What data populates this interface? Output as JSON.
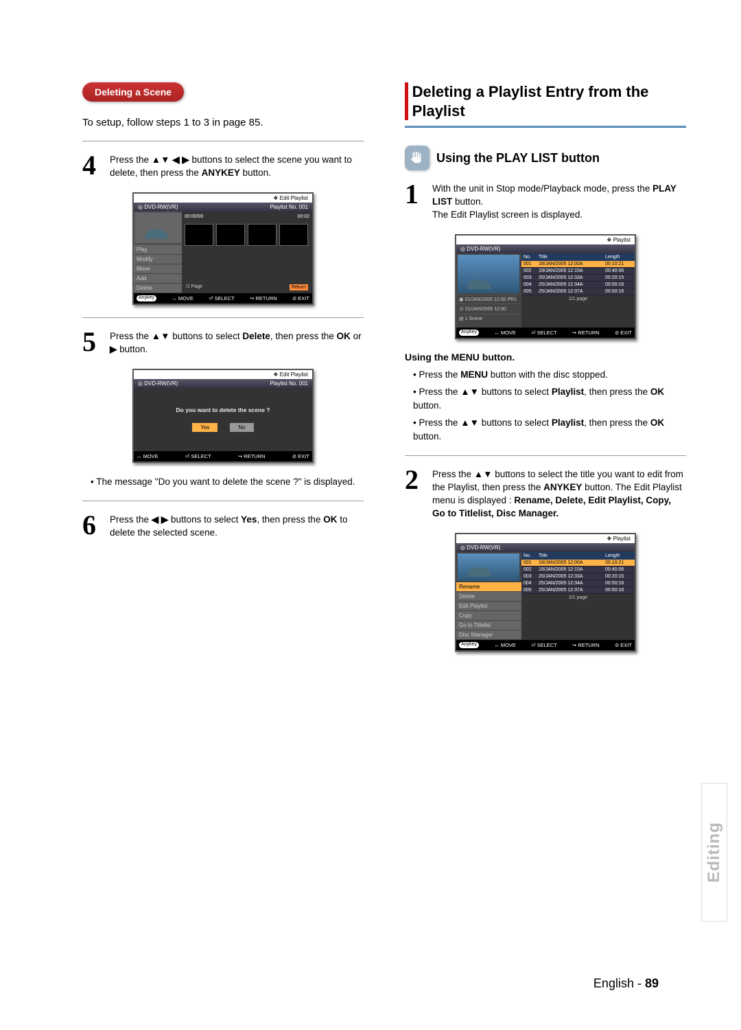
{
  "left": {
    "pill": "Deleting a Scene",
    "setup": "To setup, follow steps 1 to 3 in page 85.",
    "step4": {
      "num": "4",
      "pre": "Press the ",
      "arrows": "▲▼ ◀ ▶",
      "mid": " buttons to select the scene you want to delete, then press the ",
      "bold": "ANYKEY",
      "post": " button."
    },
    "ss1": {
      "top": "❖  Edit Playlist",
      "barL": "◎ DVD-RW(VR)",
      "barR": "Playlist No. 001",
      "side": [
        "Play",
        "Modify",
        "Move",
        "Add",
        "Delete"
      ],
      "tL": "00:00/00",
      "tR": "00:02",
      "pg": "/1 Page",
      "ret": "Return",
      "foot": {
        "ak": "Anykey",
        "mv": "↔ MOVE",
        "sel": "⏎ SELECT",
        "ret": "↪ RETURN",
        "ex": "⊘ EXIT"
      }
    },
    "step5": {
      "num": "5",
      "pre": "Press the ",
      "arrows": "▲▼",
      "mid": " buttons to select ",
      "b1": "Delete",
      "mid2": ", then press the ",
      "b2": "OK",
      "mid3": " or ",
      "arrow2": "▶",
      "post": " button."
    },
    "ss2": {
      "top": "❖  Edit Playlist",
      "barL": "◎ DVD-RW(VR)",
      "barR": "Playlist No. 001",
      "q": "Do you want to delete the scene ?",
      "yes": "Yes",
      "no": "No",
      "foot": {
        "mv": "↔ MOVE",
        "sel": "⏎ SELECT",
        "ret": "↪ RETURN",
        "ex": "⊘ EXIT"
      }
    },
    "bullet5": "The message \"Do you want to delete the scene ?\" is displayed.",
    "step6": {
      "num": "6",
      "pre": "Press the ",
      "arrows": "◀ ▶",
      "mid": " buttons to select ",
      "b1": "Yes",
      "mid2": ", then press the ",
      "b2": "OK",
      "post": " to delete the selected scene."
    }
  },
  "right": {
    "h2": "Deleting a Playlist Entry from the Playlist",
    "h3": "Using the PLAY LIST button",
    "step1": {
      "num": "1",
      "l1a": "With the unit in Stop mode/Playback mode, press the ",
      "l1b": "PLAY LIST",
      "l1c": " button.",
      "l2": "The Edit Playlist screen is displayed."
    },
    "ss3": {
      "top": "❖  Playlist",
      "barL": "◎ DVD-RW(VR)",
      "head": [
        "No.",
        "Title",
        "Length"
      ],
      "rows": [
        [
          "001",
          "18/JAN/2005 12:00A",
          "00:10:21"
        ],
        [
          "002",
          "19/JAN/2005 12:15A",
          "00:40:06"
        ],
        [
          "003",
          "20/JAN/2005 12:33A",
          "00:20:15"
        ],
        [
          "004",
          "25/JAN/2005 12:34A",
          "00:50:16"
        ],
        [
          "005",
          "25/JAN/2005 12:37A",
          "00:50:16"
        ]
      ],
      "info": [
        "▣ 01/JAN/2005 12:00 PR1",
        "⦿ 01/JAN/2005 12:00",
        "▤ 1 Scene"
      ],
      "page": "1/1 page",
      "foot": {
        "ak": "Anykey",
        "mv": "↔ MOVE",
        "sel": "⏎ SELECT",
        "ret": "↪ RETURN",
        "ex": "⊘ EXIT"
      }
    },
    "menuHead": "Using the MENU button.",
    "menu": {
      "b1a": "Press the ",
      "b1b": "MENU",
      "b1c": " button with the disc stopped.",
      "b2a": "Press the ",
      "b2arr": "▲▼",
      "b2b": " buttons to select ",
      "b2c": "Playlist",
      "b2d": ", then press the ",
      "b2e": "OK",
      "b2f": " button.",
      "b3a": "Press the ",
      "b3arr": "▲▼",
      "b3b": " buttons to select ",
      "b3c": "Playlist",
      "b3d": ", then press the ",
      "b3e": "OK",
      "b3f": " button."
    },
    "step2": {
      "num": "2",
      "l1a": "Press the ",
      "l1arr": "▲▼",
      "l1b": " buttons to select the title you want to edit from the Playlist, then press the ",
      "l1c": "ANYKEY",
      "l1d": " button.",
      "l2a": "The Edit Playlist menu is displayed : ",
      "l2items": "Rename, Delete, Edit Playlist, Copy, Go to Titlelist, Disc Manager."
    },
    "ss4": {
      "top": "❖  Playlist",
      "barL": "◎ DVD-RW(VR)",
      "head": [
        "No.",
        "Title",
        "Length"
      ],
      "side": [
        "Rename",
        "Delete",
        "Edit Playlist",
        "Copy",
        "Go to Titlelist",
        "Disc Manager"
      ],
      "rows": [
        [
          "001",
          "18/JAN/2005 12:00A",
          "00:10:21"
        ],
        [
          "002",
          "19/JAN/2005 12:15A",
          "00:40:06"
        ],
        [
          "003",
          "20/JAN/2005 12:33A",
          "00:20:15"
        ],
        [
          "004",
          "25/JAN/2005 12:34A",
          "00:50:16"
        ],
        [
          "005",
          "25/JAN/2005 12:37A",
          "00:50:16"
        ]
      ],
      "page": "1/1 page",
      "foot": {
        "ak": "Anykey",
        "mv": "↔ MOVE",
        "sel": "⏎ SELECT",
        "ret": "↪ RETURN",
        "ex": "⊘ EXIT"
      }
    }
  },
  "tab": "Editing",
  "footerA": "English - ",
  "footerB": "89"
}
